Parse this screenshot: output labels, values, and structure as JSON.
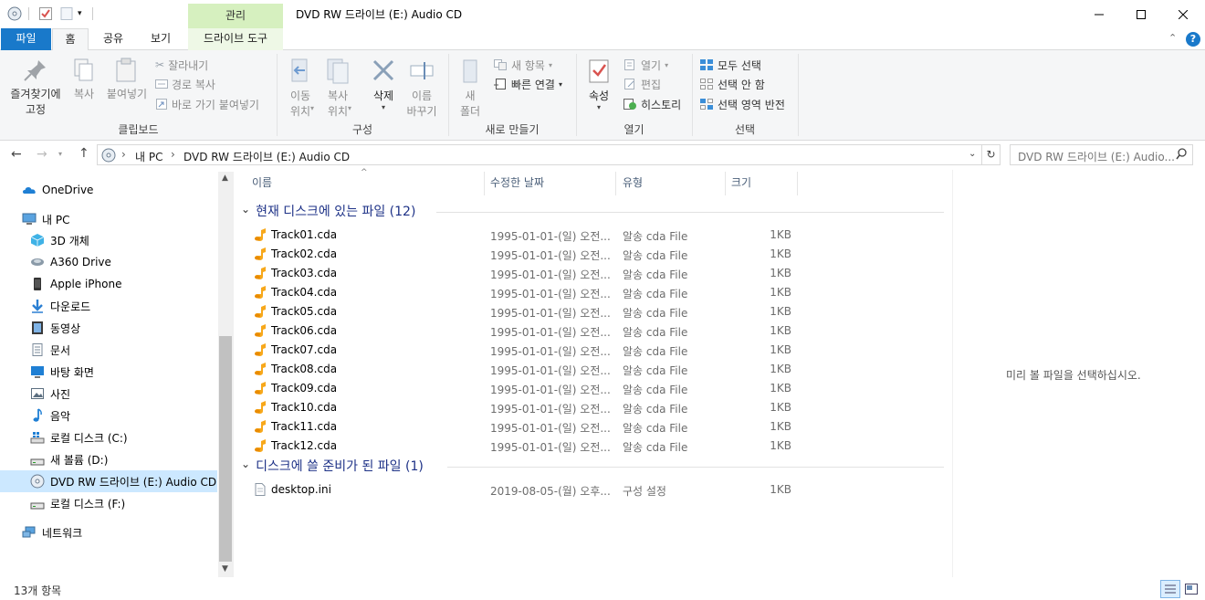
{
  "window": {
    "title": "DVD RW 드라이브 (E:) Audio CD",
    "context_tab": "관리"
  },
  "ribbon_tabs": {
    "file": "파일",
    "home": "홈",
    "share": "공유",
    "view": "보기",
    "drive_tools": "드라이브 도구"
  },
  "ribbon": {
    "clipboard": {
      "pin_line1": "즐겨찾기에",
      "pin_line2": "고정",
      "copy": "복사",
      "paste": "붙여넣기",
      "cut": "잘라내기",
      "copy_path": "경로 복사",
      "paste_shortcut": "바로 가기 붙여넣기",
      "label": "클립보드"
    },
    "organize": {
      "move_line1": "이동",
      "move_line2": "위치",
      "copyto_line1": "복사",
      "copyto_line2": "위치",
      "delete": "삭제",
      "rename_line1": "이름",
      "rename_line2": "바꾸기",
      "label": "구성"
    },
    "new": {
      "folder_line1": "새",
      "folder_line2": "폴더",
      "new_item": "새 항목",
      "easy_access": "빠른 연결",
      "label": "새로 만들기"
    },
    "open": {
      "properties": "속성",
      "open": "열기",
      "edit": "편집",
      "history": "히스토리",
      "label": "열기"
    },
    "select": {
      "select_all": "모두 선택",
      "select_none": "선택 안 함",
      "invert": "선택 영역 반전",
      "label": "선택"
    }
  },
  "address": {
    "crumb_pc": "내 PC",
    "crumb_drive": "DVD RW 드라이브 (E:) Audio CD",
    "search_placeholder": "DVD RW 드라이브 (E:) Audio..."
  },
  "nav": {
    "onedrive": "OneDrive",
    "pc": "내 PC",
    "items": [
      {
        "label": "3D 개체",
        "icon": "cube-icon"
      },
      {
        "label": "A360 Drive",
        "icon": "a360-drive-icon"
      },
      {
        "label": "Apple iPhone",
        "icon": "phone-icon"
      },
      {
        "label": "다운로드",
        "icon": "download-icon"
      },
      {
        "label": "동영상",
        "icon": "video-icon"
      },
      {
        "label": "문서",
        "icon": "document-icon"
      },
      {
        "label": "바탕 화면",
        "icon": "desktop-icon"
      },
      {
        "label": "사진",
        "icon": "pictures-icon"
      },
      {
        "label": "음악",
        "icon": "music-icon"
      },
      {
        "label": "로컬 디스크 (C:)",
        "icon": "windows-drive-icon"
      },
      {
        "label": "새 볼륨 (D:)",
        "icon": "drive-icon"
      },
      {
        "label": "DVD RW 드라이브 (E:) Audio CD",
        "icon": "dvd-icon"
      },
      {
        "label": "로컬 디스크 (F:)",
        "icon": "drive-icon"
      }
    ],
    "network": "네트워크"
  },
  "columns": {
    "name": "이름",
    "date": "수정한 날짜",
    "type": "유형",
    "size": "크기"
  },
  "groups": [
    {
      "title": "현재 디스크에 있는 파일 (12)",
      "files": [
        {
          "name": "Track01.cda",
          "date": "1995-01-01-(일) 오전...",
          "type": "알송 cda File",
          "size": "1KB"
        },
        {
          "name": "Track02.cda",
          "date": "1995-01-01-(일) 오전...",
          "type": "알송 cda File",
          "size": "1KB"
        },
        {
          "name": "Track03.cda",
          "date": "1995-01-01-(일) 오전...",
          "type": "알송 cda File",
          "size": "1KB"
        },
        {
          "name": "Track04.cda",
          "date": "1995-01-01-(일) 오전...",
          "type": "알송 cda File",
          "size": "1KB"
        },
        {
          "name": "Track05.cda",
          "date": "1995-01-01-(일) 오전...",
          "type": "알송 cda File",
          "size": "1KB"
        },
        {
          "name": "Track06.cda",
          "date": "1995-01-01-(일) 오전...",
          "type": "알송 cda File",
          "size": "1KB"
        },
        {
          "name": "Track07.cda",
          "date": "1995-01-01-(일) 오전...",
          "type": "알송 cda File",
          "size": "1KB"
        },
        {
          "name": "Track08.cda",
          "date": "1995-01-01-(일) 오전...",
          "type": "알송 cda File",
          "size": "1KB"
        },
        {
          "name": "Track09.cda",
          "date": "1995-01-01-(일) 오전...",
          "type": "알송 cda File",
          "size": "1KB"
        },
        {
          "name": "Track10.cda",
          "date": "1995-01-01-(일) 오전...",
          "type": "알송 cda File",
          "size": "1KB"
        },
        {
          "name": "Track11.cda",
          "date": "1995-01-01-(일) 오전...",
          "type": "알송 cda File",
          "size": "1KB"
        },
        {
          "name": "Track12.cda",
          "date": "1995-01-01-(일) 오전...",
          "type": "알송 cda File",
          "size": "1KB"
        }
      ]
    },
    {
      "title": "디스크에 쓸 준비가 된 파일 (1)",
      "files": [
        {
          "name": "desktop.ini",
          "date": "2019-08-05-(월) 오후...",
          "type": "구성 설정",
          "size": "1KB"
        }
      ]
    }
  ],
  "preview_text": "미리 볼 파일을 선택하십시오.",
  "status": {
    "count": "13개 항목"
  },
  "colors": {
    "accent": "#1979ca",
    "context_tab_bg": "#d6f0bf",
    "selection": "#cce8ff",
    "group_header": "#1e3287"
  }
}
